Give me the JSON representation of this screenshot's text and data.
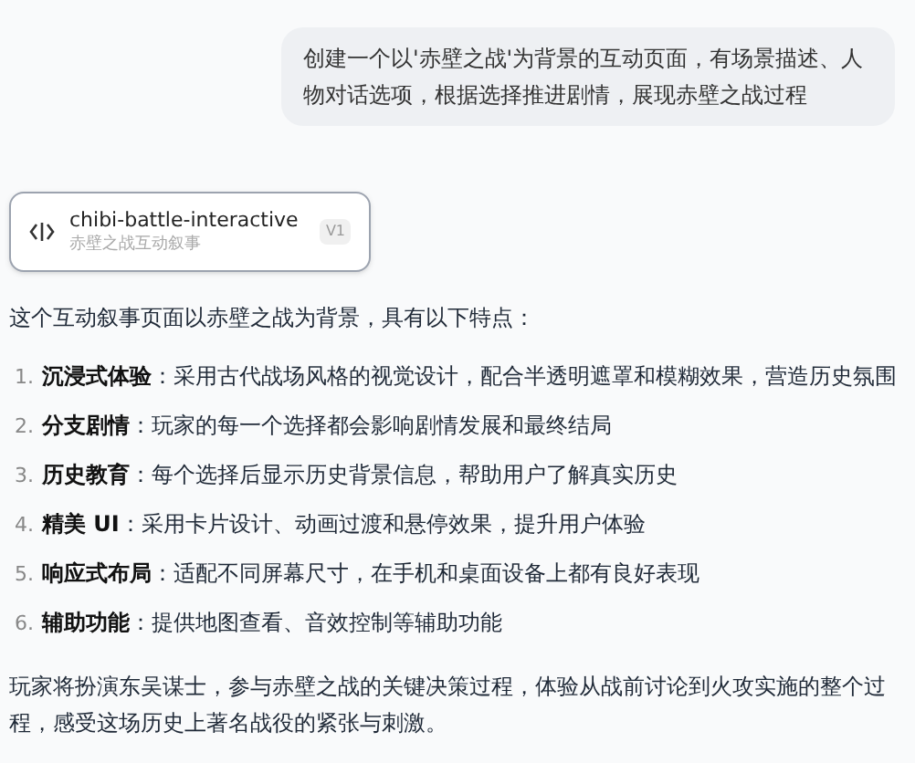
{
  "user_message": "创建一个以'赤壁之战'为背景的互动页面，有场景描述、人物对话选项，根据选择推进剧情，展现赤壁之战过程",
  "artifact": {
    "title": "chibi-battle-interactive",
    "subtitle": "赤壁之战互动叙事",
    "version": "V1"
  },
  "intro": "这个互动叙事页面以赤壁之战为背景，具有以下特点：",
  "features": [
    {
      "number": "1.",
      "title": "沉浸式体验",
      "text": "：采用古代战场风格的视觉设计，配合半透明遮罩和模糊效果，营造历史氛围"
    },
    {
      "number": "2.",
      "title": "分支剧情",
      "text": "：玩家的每一个选择都会影响剧情发展和最终结局"
    },
    {
      "number": "3.",
      "title": "历史教育",
      "text": "：每个选择后显示历史背景信息，帮助用户了解真实历史"
    },
    {
      "number": "4.",
      "title": "精美 UI",
      "text": "：采用卡片设计、动画过渡和悬停效果，提升用户体验"
    },
    {
      "number": "5.",
      "title": "响应式布局",
      "text": "：适配不同屏幕尺寸，在手机和桌面设备上都有良好表现"
    },
    {
      "number": "6.",
      "title": "辅助功能",
      "text": "：提供地图查看、音效控制等辅助功能"
    }
  ],
  "conclusion": "玩家将扮演东吴谋士，参与赤壁之战的关键决策过程，体验从战前讨论到火攻实施的整个过程，感受这场历史上著名战役的紧张与刺激。"
}
